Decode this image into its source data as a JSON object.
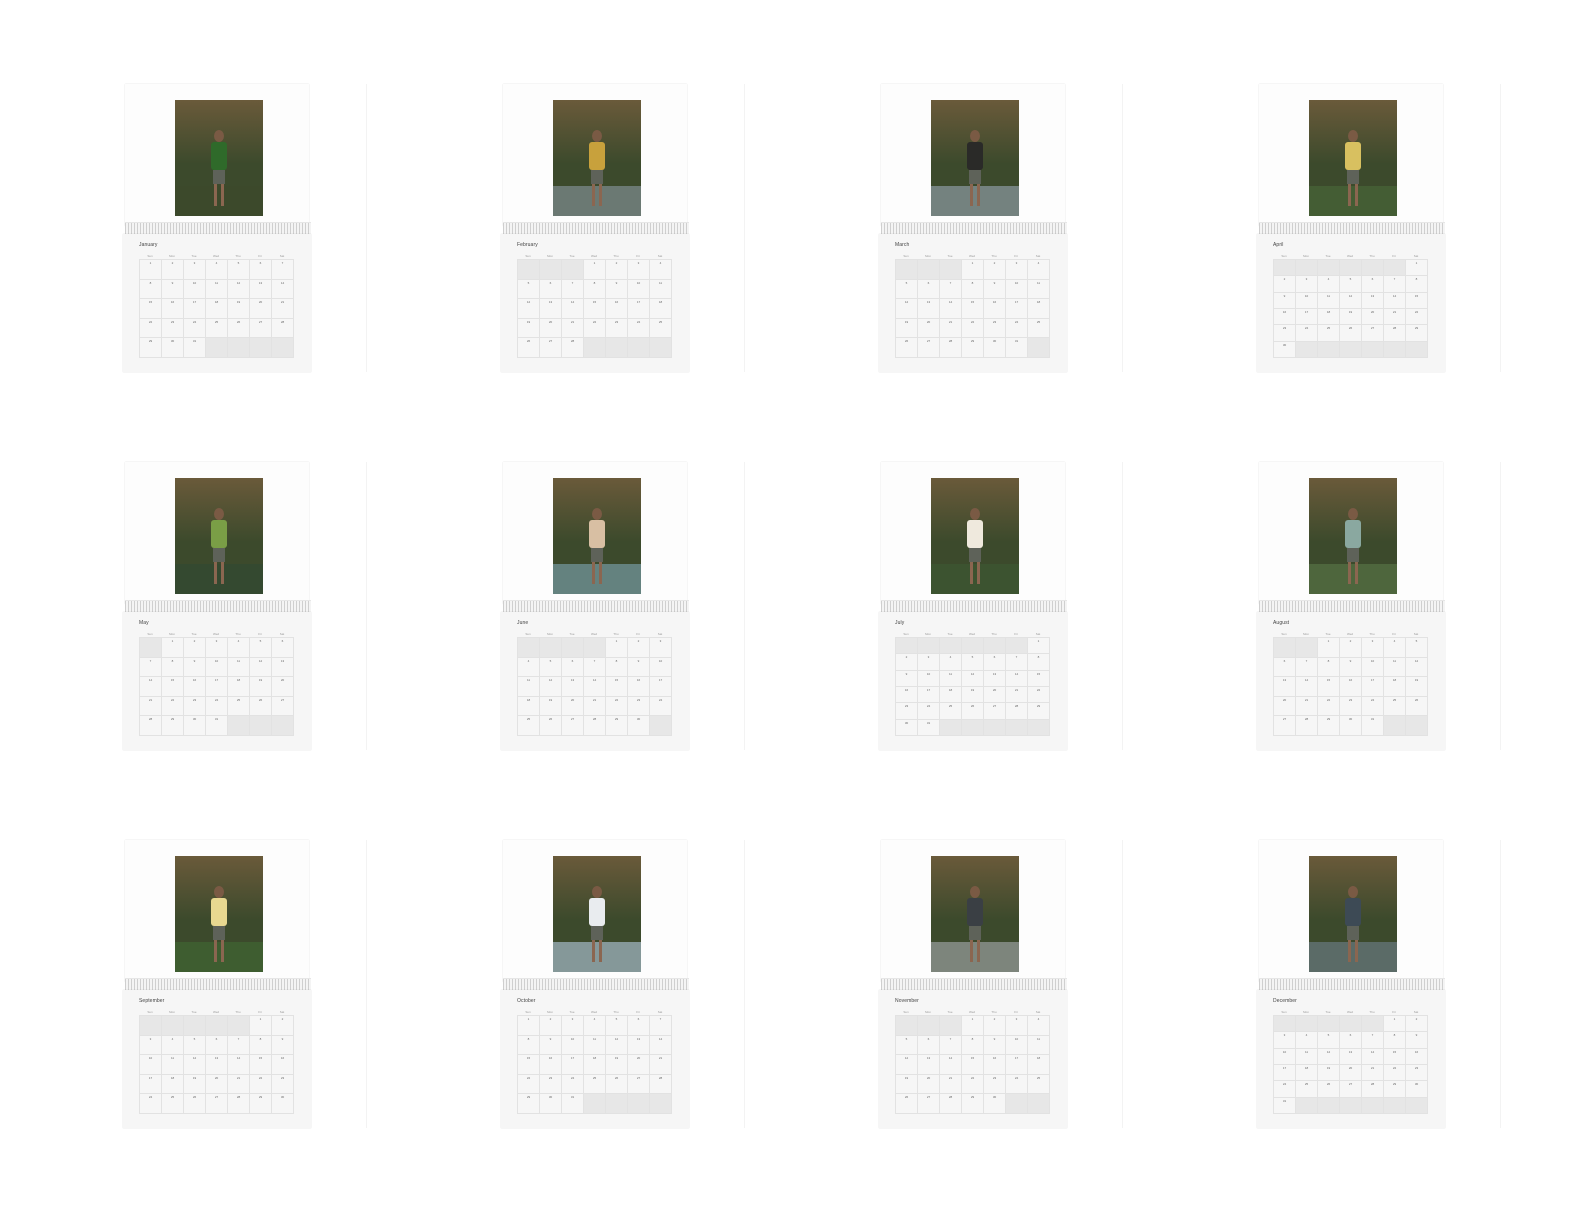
{
  "weekday_labels": [
    "Sun",
    "Mon",
    "Tue",
    "Wed",
    "Thu",
    "Fri",
    "Sat"
  ],
  "months": [
    {
      "name": "January",
      "start": 0,
      "days": 31,
      "photo": "forest-vines",
      "colors": [
        "#3c4a2c",
        "#6a5a3a",
        "#2f6a2a"
      ]
    },
    {
      "name": "February",
      "start": 3,
      "days": 28,
      "photo": "shack-seated",
      "colors": [
        "#8a9aa3",
        "#cfd6d8",
        "#c8a13c"
      ]
    },
    {
      "name": "March",
      "start": 3,
      "days": 31,
      "photo": "rock-shore",
      "colors": [
        "#9aa8b8",
        "#cdd3db",
        "#2a2a28"
      ]
    },
    {
      "name": "April",
      "start": 6,
      "days": 30,
      "photo": "garden-tree",
      "colors": [
        "#4a6a3a",
        "#8aa070",
        "#d8c060"
      ]
    },
    {
      "name": "May",
      "start": 1,
      "days": 31,
      "photo": "meadow-mountain",
      "colors": [
        "#2f4a34",
        "#6a8a52",
        "#7a9e46"
      ]
    },
    {
      "name": "June",
      "start": 4,
      "days": 30,
      "photo": "beach-waves",
      "colors": [
        "#7fa9b8",
        "#e0e6e8",
        "#d8bfa3"
      ]
    },
    {
      "name": "July",
      "start": 6,
      "days": 31,
      "photo": "palms-bamboo",
      "colors": [
        "#3c5a34",
        "#7a8f5a",
        "#efe9dd"
      ]
    },
    {
      "name": "August",
      "start": 2,
      "days": 31,
      "photo": "tropical-porch",
      "colors": [
        "#5a7a4a",
        "#f0ede6",
        "#8aa8a0"
      ]
    },
    {
      "name": "September",
      "start": 5,
      "days": 30,
      "photo": "giant-leaves",
      "colors": [
        "#3f6a34",
        "#7ea05a",
        "#e8d890"
      ]
    },
    {
      "name": "October",
      "start": 0,
      "days": 31,
      "photo": "sky-reach",
      "colors": [
        "#b5cde3",
        "#8fa68a",
        "#e9ecef"
      ]
    },
    {
      "name": "November",
      "start": 3,
      "days": 30,
      "photo": "ocean-standing",
      "colors": [
        "#a8adb3",
        "#6a7279",
        "#3a3f44"
      ]
    },
    {
      "name": "December",
      "start": 5,
      "days": 31,
      "photo": "swimming-sea",
      "colors": [
        "#6f8290",
        "#a7b4bd",
        "#3d4a55"
      ]
    }
  ]
}
